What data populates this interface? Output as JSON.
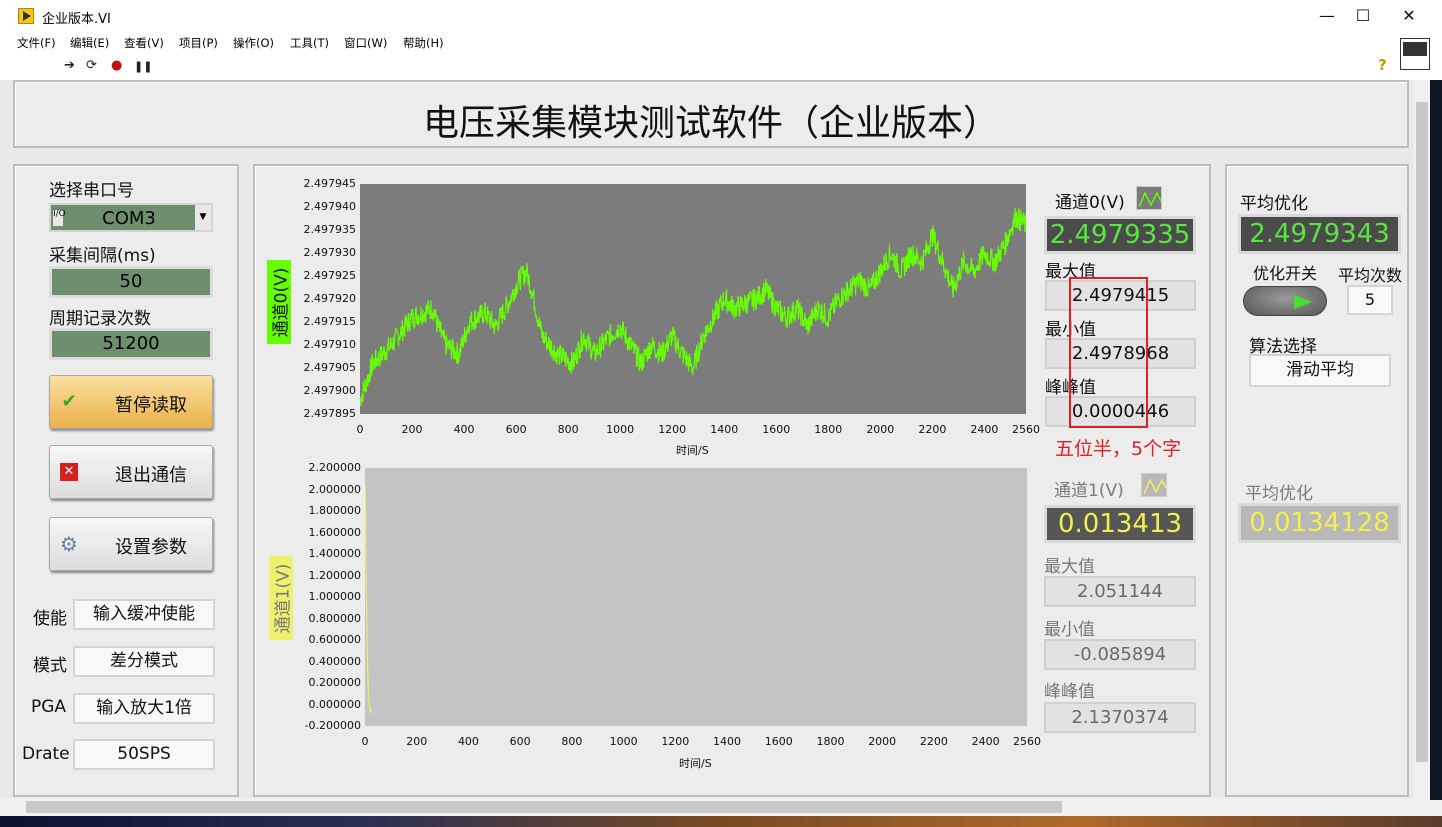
{
  "window": {
    "title": "企业版本.VI",
    "min": "—",
    "max": "☐",
    "close": "✕"
  },
  "menu": [
    "文件(F)",
    "编辑(E)",
    "查看(V)",
    "项目(P)",
    "操作(O)",
    "工具(T)",
    "窗口(W)",
    "帮助(H)"
  ],
  "toolbar": {
    "run": "➔",
    "run_cont": "⟳",
    "abort": "●",
    "pause": "❚❚",
    "help": "?"
  },
  "banner": "电压采集模块测试软件（企业版本）",
  "left": {
    "port_label": "选择串口号",
    "port_value": "COM3",
    "port_prefix": "I/O",
    "interval_label": "采集间隔(ms)",
    "interval_value": "50",
    "record_label": "周期记录次数",
    "record_value": "51200",
    "btn_pause": "暂停读取",
    "btn_exit": "退出通信",
    "btn_settings": "设置参数",
    "enable_label": "使能",
    "enable_value": "输入缓冲使能",
    "mode_label": "模式",
    "mode_value": "差分模式",
    "pga_label": "PGA",
    "pga_value": "输入放大1倍",
    "drate_label": "Drate",
    "drate_value": "50SPS"
  },
  "ch0": {
    "legend": "通道0(V)",
    "value": "2.4979335",
    "max_label": "最大值",
    "max": "2.4979415",
    "min_label": "最小值",
    "min": "2.4978968",
    "pp_label": "峰峰值",
    "pp": "0.0000446",
    "annotation": "五位半，5个字"
  },
  "ch1": {
    "legend": "通道1(V)",
    "value": "0.013413",
    "max_label": "最大值",
    "max": "2.051144",
    "min_label": "最小值",
    "min": "-0.085894",
    "pp_label": "峰峰值",
    "pp": "2.1370374"
  },
  "right": {
    "avg_label": "平均优化",
    "avg_value": "2.4979343",
    "switch_label": "优化开关",
    "count_label": "平均次数",
    "count_value": "5",
    "algo_label": "算法选择",
    "algo_value": "滑动平均",
    "avg2_label": "平均优化",
    "avg2_value": "0.0134128"
  },
  "colors": {
    "ch0_line": "#66ff00",
    "ch1_line": "#f0f060",
    "plot0_bg": "#7c7c7c",
    "plot1_bg": "#c4c4c4"
  },
  "chart_data": [
    {
      "type": "line",
      "xlabel": "时间/S",
      "ylabel": "通道0(V)",
      "xlim": [
        0,
        2560
      ],
      "ylim": [
        2.497895,
        2.497945
      ],
      "x_ticks": [
        "0",
        "200",
        "400",
        "600",
        "800",
        "1000",
        "1200",
        "1400",
        "1600",
        "1800",
        "2000",
        "2200",
        "2400",
        "2560"
      ],
      "y_ticks": [
        "2.497945",
        "2.497940",
        "2.497935",
        "2.497930",
        "2.497925",
        "2.497920",
        "2.497915",
        "2.497910",
        "2.497905",
        "2.497900",
        "2.497895"
      ],
      "series": [
        {
          "x": [
            0,
            50,
            120,
            200,
            280,
            300,
            330,
            380,
            420,
            480,
            520,
            560,
            610,
            640,
            660,
            700,
            760,
            820,
            860,
            900,
            960,
            1000,
            1040,
            1080,
            1120,
            1160,
            1200,
            1240,
            1280,
            1320,
            1360,
            1400,
            1440,
            1480,
            1520,
            1560,
            1600,
            1640,
            1680,
            1720,
            1760,
            1800,
            1840,
            1880,
            1920,
            1960,
            2000,
            2040,
            2080,
            2120,
            2160,
            2200,
            2240,
            2280,
            2320,
            2360,
            2400,
            2440,
            2480,
            2520,
            2560
          ],
          "y": [
            2.497898,
            2.497906,
            2.49791,
            2.497916,
            2.497918,
            2.497914,
            2.49791,
            2.497908,
            2.497915,
            2.497917,
            2.497914,
            2.497918,
            2.497924,
            2.497926,
            2.497922,
            2.497912,
            2.497908,
            2.497906,
            2.497912,
            2.497908,
            2.497912,
            2.497914,
            2.49791,
            2.497906,
            2.49791,
            2.497908,
            2.497912,
            2.497908,
            2.497905,
            2.497912,
            2.497916,
            2.49792,
            2.497918,
            2.497919,
            2.49792,
            2.497922,
            2.497918,
            2.497916,
            2.497918,
            2.497914,
            2.497918,
            2.497916,
            2.49792,
            2.497922,
            2.497924,
            2.497922,
            2.497926,
            2.49793,
            2.497926,
            2.49793,
            2.497928,
            2.497934,
            2.497928,
            2.497922,
            2.497928,
            2.497926,
            2.49793,
            2.497928,
            2.497932,
            2.497938,
            2.497936
          ]
        }
      ]
    },
    {
      "type": "line",
      "xlabel": "时间/S",
      "ylabel": "通道1(V)",
      "xlim": [
        0,
        2560
      ],
      "ylim": [
        -0.2,
        2.2
      ],
      "x_ticks": [
        "0",
        "200",
        "400",
        "600",
        "800",
        "1000",
        "1200",
        "1400",
        "1600",
        "1800",
        "2000",
        "2200",
        "2400",
        "2560"
      ],
      "y_ticks": [
        "2.200000",
        "2.000000",
        "1.800000",
        "1.600000",
        "1.400000",
        "1.200000",
        "1.000000",
        "0.800000",
        "0.600000",
        "0.400000",
        "0.200000",
        "0.000000",
        "-0.200000"
      ],
      "series": [
        {
          "x": [
            0,
            2,
            4,
            6,
            8,
            10,
            12,
            14,
            16,
            18,
            20,
            22,
            24
          ],
          "y": [
            2.05,
            1.8,
            1.3,
            0.9,
            0.6,
            0.35,
            0.2,
            0.1,
            0.03,
            -0.02,
            -0.06,
            -0.08,
            -0.04
          ]
        }
      ]
    }
  ]
}
